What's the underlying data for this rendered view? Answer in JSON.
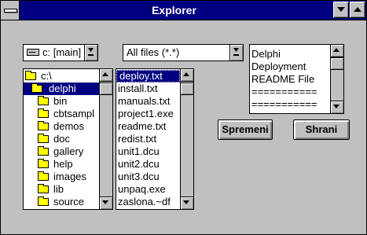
{
  "window": {
    "title": "Explorer"
  },
  "drive_combo": {
    "value": "c: [main]",
    "icon": "drive-icon"
  },
  "filter_combo": {
    "value": "All files (*.*)"
  },
  "dir_list": {
    "items": [
      {
        "label": "c:\\",
        "icon": "open-folder-icon",
        "level": 0
      },
      {
        "label": "delphi",
        "icon": "open-folder-icon",
        "level": 1,
        "selected": true
      },
      {
        "label": "bin",
        "icon": "folder-icon",
        "level": 2
      },
      {
        "label": "cbtsampl",
        "icon": "folder-icon",
        "level": 2
      },
      {
        "label": "demos",
        "icon": "folder-icon",
        "level": 2
      },
      {
        "label": "doc",
        "icon": "folder-icon",
        "level": 2
      },
      {
        "label": "gallery",
        "icon": "folder-icon",
        "level": 2
      },
      {
        "label": "help",
        "icon": "folder-icon",
        "level": 2
      },
      {
        "label": "images",
        "icon": "folder-icon",
        "level": 2
      },
      {
        "label": "lib",
        "icon": "folder-icon",
        "level": 2
      },
      {
        "label": "source",
        "icon": "folder-icon",
        "level": 2
      }
    ]
  },
  "file_list": {
    "items": [
      {
        "label": "deploy.txt",
        "selected": true
      },
      {
        "label": "install.txt"
      },
      {
        "label": "manuals.txt"
      },
      {
        "label": "project1.exe"
      },
      {
        "label": "readme.txt"
      },
      {
        "label": "redist.txt"
      },
      {
        "label": "unit1.dcu"
      },
      {
        "label": "unit2.dcu"
      },
      {
        "label": "unit3.dcu"
      },
      {
        "label": "unpaq.exe"
      },
      {
        "label": "zaslona.~df"
      }
    ]
  },
  "memo": {
    "lines": [
      "Delphi",
      "Deployment",
      "README File",
      "===========",
      "==========="
    ]
  },
  "buttons": {
    "save_as_label": "Spremeni",
    "save_label": "Shrani"
  },
  "colors": {
    "titlebar": "#000080",
    "face": "#c0c0c0",
    "selection": "#000080"
  }
}
